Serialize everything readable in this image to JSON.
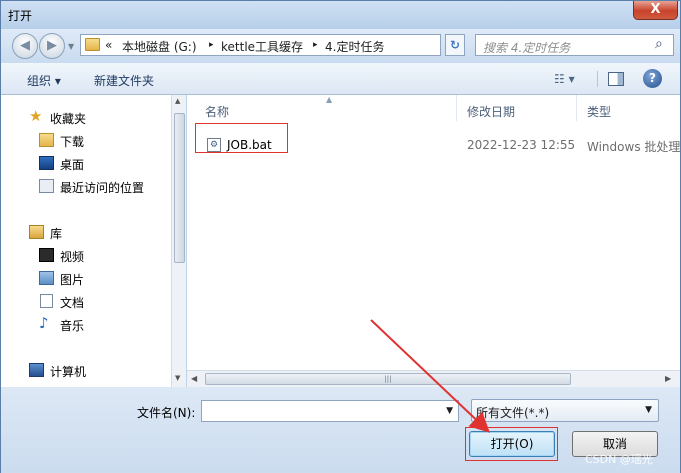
{
  "window": {
    "title": "打开",
    "close_label": "X"
  },
  "nav": {
    "back_icon": "back-arrow-icon",
    "forward_icon": "forward-arrow-icon",
    "breadcrumb": [
      "«",
      "本地磁盘 (G:)",
      "kettle工具缓存",
      "4.定时任务"
    ],
    "breadcrumb_sep": "▸"
  },
  "search": {
    "placeholder": "搜索 4.定时任务"
  },
  "toolbar": {
    "organize": "组织 ▾",
    "new_folder": "新建文件夹",
    "help": "?"
  },
  "sidebar": {
    "favorites": {
      "label": "收藏夹",
      "items": [
        "下载",
        "桌面",
        "最近访问的位置"
      ]
    },
    "libraries": {
      "label": "库",
      "items": [
        "视频",
        "图片",
        "文档",
        "音乐"
      ]
    },
    "computer": {
      "label": "计算机"
    }
  },
  "columns": {
    "name": "名称",
    "modified": "修改日期",
    "type": "类型"
  },
  "files": [
    {
      "name": "JOB.bat",
      "modified": "2022-12-23 12:55",
      "type": "Windows 批处理"
    }
  ],
  "bottom": {
    "filename_label": "文件名(N):",
    "filename_value": "",
    "filter": "所有文件(*.*)",
    "open": "打开(O)",
    "cancel": "取消"
  },
  "watermark": "CSDN @瑶光",
  "colors": {
    "highlight": "#e13232",
    "accent": "#3c7fb1"
  }
}
